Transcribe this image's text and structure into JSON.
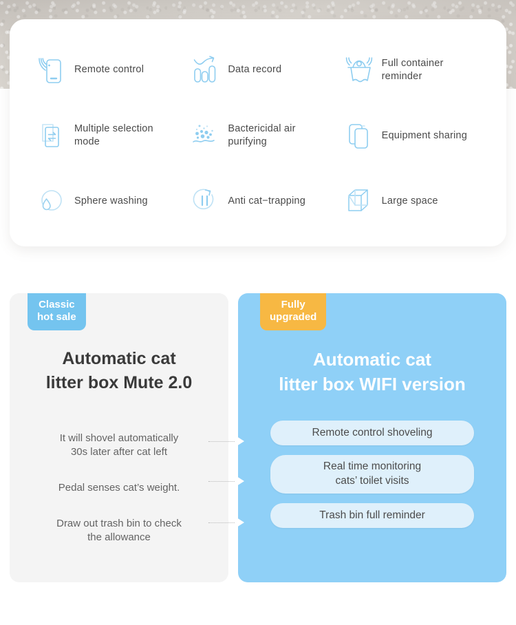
{
  "features": {
    "items": [
      {
        "id": "remote-control",
        "icon": "phone-signal-icon",
        "label": "Remote control"
      },
      {
        "id": "data-record",
        "icon": "bar-chart-arrow-icon",
        "label": "Data record"
      },
      {
        "id": "full-container",
        "icon": "bin-full-alert-icon",
        "label": "Full container\nreminder"
      },
      {
        "id": "multiple-selection",
        "icon": "swap-documents-icon",
        "label": "Multiple selection\nmode"
      },
      {
        "id": "bactericidal-air",
        "icon": "bubbles-wave-icon",
        "label": "Bactericidal air\npurifying"
      },
      {
        "id": "equipment-sharing",
        "icon": "two-phones-icon",
        "label": "Equipment sharing"
      },
      {
        "id": "sphere-washing",
        "icon": "droplet-circle-icon",
        "label": "Sphere washing"
      },
      {
        "id": "anti-cat-trapping",
        "icon": "pause-refresh-icon",
        "label": "Anti cat−trapping"
      },
      {
        "id": "large-space",
        "icon": "cube-icon",
        "label": "Large space"
      }
    ]
  },
  "comparison": {
    "classic": {
      "badge": "Classic\nhot sale",
      "badge_color": "#74c4ef",
      "title": "Automatic cat\nlitter box Mute 2.0",
      "background_color": "#f4f4f4",
      "rows": [
        "It will shovel automatically\n30s later after cat left",
        "Pedal senses cat’s weight.",
        "Draw out trash bin to check\nthe allowance"
      ]
    },
    "wifi": {
      "badge": "Fully\nupgraded",
      "badge_color": "#f7b843",
      "title": "Automatic cat\nlitter box WIFI version",
      "background_color": "#8fd0f7",
      "pills": [
        "Remote control shoveling",
        "Real time monitoring\ncats’ toilet visits",
        "Trash bin full reminder"
      ]
    }
  },
  "theme": {
    "icon_color": "#8ecdf0",
    "text_color": "#4a4a4a",
    "pill_color": "#dff0fb"
  }
}
